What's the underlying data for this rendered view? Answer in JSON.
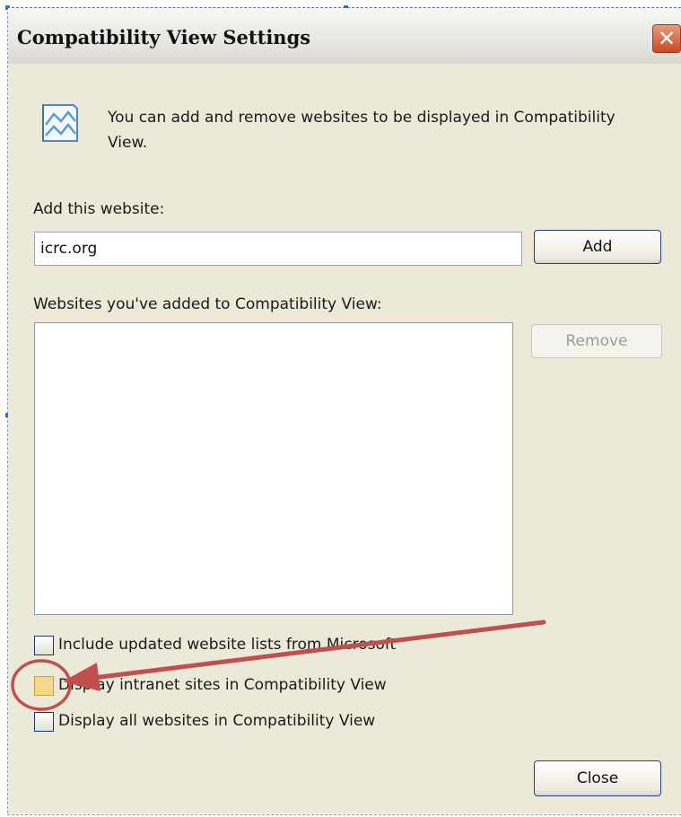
{
  "dialog": {
    "title": "Compatibility View Settings",
    "close_glyph": "✕",
    "info_icon": "compatibility-view-icon",
    "info_text": "You can add and remove websites to be displayed in Compatibility View."
  },
  "add_section": {
    "label": "Add this website:",
    "input_value": "icrc.org",
    "add_button": "Add"
  },
  "list_section": {
    "label": "Websites you've added to Compatibility View:",
    "items": [],
    "remove_button": "Remove"
  },
  "checkboxes": [
    {
      "label": "Include updated website lists from Microsoft",
      "checked": false
    },
    {
      "label": "Display intranet sites in Compatibility View",
      "checked": false,
      "highlighted": true
    },
    {
      "label": "Display all websites in Compatibility View",
      "checked": false
    }
  ],
  "footer": {
    "close_button": "Close"
  },
  "colors": {
    "annotation": "#c0504d",
    "title_close": "#c84a23"
  }
}
